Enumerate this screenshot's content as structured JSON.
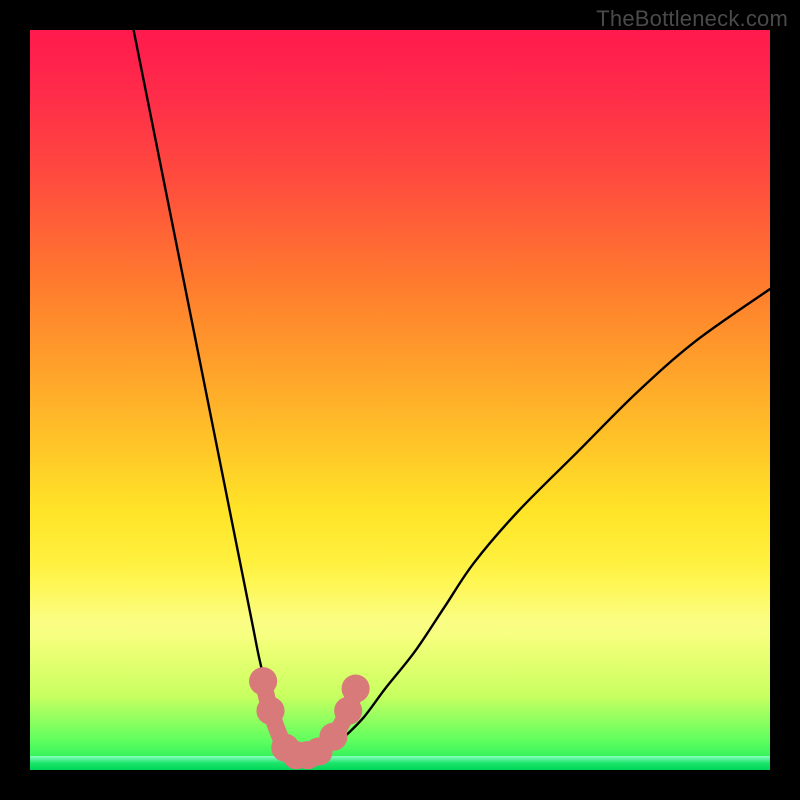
{
  "watermark": "TheBottleneck.com",
  "colors": {
    "frame": "#000000",
    "curve": "#000000",
    "marker_fill": "#d97a7a",
    "marker_stroke": "#c96060",
    "gradient_stops": [
      "#ff1a4d",
      "#ff7a2e",
      "#ffe427",
      "#f6ff7a",
      "#1be56a"
    ]
  },
  "chart_data": {
    "type": "line",
    "title": "",
    "xlabel": "",
    "ylabel": "",
    "xlim": [
      0,
      100
    ],
    "ylim": [
      0,
      100
    ],
    "grid": false,
    "legend": false,
    "annotations": [],
    "description": "Two smooth black curves descending from top toward a common minimum near the bottom-center-left of a vertical rainbow gradient (red→orange→yellow→green). Salmon-colored rounded markers cluster at the trough. No axes, ticks, or labels are rendered.",
    "series": [
      {
        "name": "left_branch",
        "x": [
          14,
          16,
          18,
          20,
          22,
          24,
          26,
          28,
          30,
          31,
          32,
          33,
          34,
          35,
          36
        ],
        "y": [
          100,
          90,
          80,
          70,
          60,
          50,
          40,
          30,
          20,
          15,
          11,
          8,
          5,
          3,
          2
        ]
      },
      {
        "name": "right_branch",
        "x": [
          40,
          42,
          45,
          48,
          52,
          56,
          60,
          66,
          74,
          82,
          90,
          100
        ],
        "y": [
          2,
          4,
          7,
          11,
          16,
          22,
          28,
          35,
          43,
          51,
          58,
          65
        ]
      }
    ],
    "markers": {
      "name": "trough_markers",
      "points": [
        {
          "x": 31.5,
          "y": 12
        },
        {
          "x": 32.5,
          "y": 8
        },
        {
          "x": 34.5,
          "y": 3
        },
        {
          "x": 36.0,
          "y": 2
        },
        {
          "x": 37.5,
          "y": 2
        },
        {
          "x": 39.0,
          "y": 2.5
        },
        {
          "x": 41.0,
          "y": 4.5
        },
        {
          "x": 43.0,
          "y": 8
        },
        {
          "x": 44.0,
          "y": 11
        }
      ],
      "radius_data_units": 1.9
    }
  }
}
